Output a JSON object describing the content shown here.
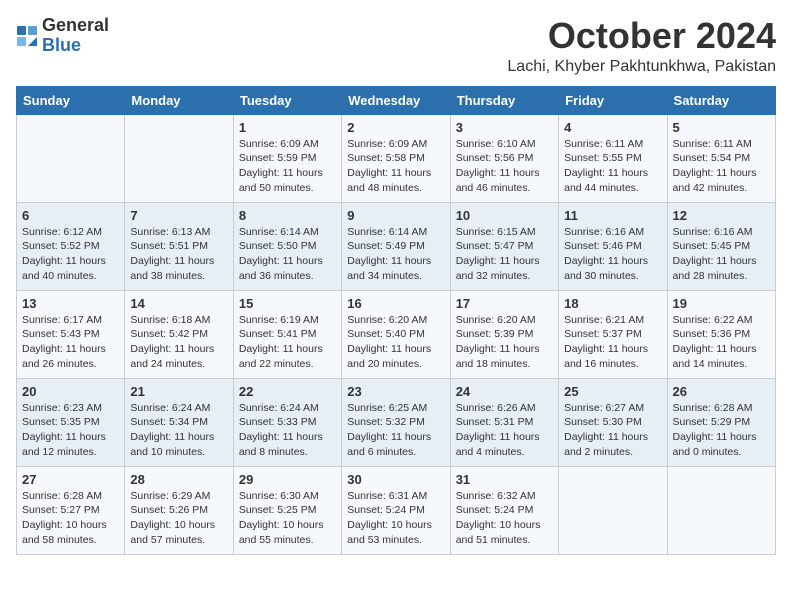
{
  "header": {
    "logo_general": "General",
    "logo_blue": "Blue",
    "month": "October 2024",
    "location": "Lachi, Khyber Pakhtunkhwa, Pakistan"
  },
  "weekdays": [
    "Sunday",
    "Monday",
    "Tuesday",
    "Wednesday",
    "Thursday",
    "Friday",
    "Saturday"
  ],
  "weeks": [
    [
      {
        "day": "",
        "text": ""
      },
      {
        "day": "",
        "text": ""
      },
      {
        "day": "1",
        "text": "Sunrise: 6:09 AM\nSunset: 5:59 PM\nDaylight: 11 hours and 50 minutes."
      },
      {
        "day": "2",
        "text": "Sunrise: 6:09 AM\nSunset: 5:58 PM\nDaylight: 11 hours and 48 minutes."
      },
      {
        "day": "3",
        "text": "Sunrise: 6:10 AM\nSunset: 5:56 PM\nDaylight: 11 hours and 46 minutes."
      },
      {
        "day": "4",
        "text": "Sunrise: 6:11 AM\nSunset: 5:55 PM\nDaylight: 11 hours and 44 minutes."
      },
      {
        "day": "5",
        "text": "Sunrise: 6:11 AM\nSunset: 5:54 PM\nDaylight: 11 hours and 42 minutes."
      }
    ],
    [
      {
        "day": "6",
        "text": "Sunrise: 6:12 AM\nSunset: 5:52 PM\nDaylight: 11 hours and 40 minutes."
      },
      {
        "day": "7",
        "text": "Sunrise: 6:13 AM\nSunset: 5:51 PM\nDaylight: 11 hours and 38 minutes."
      },
      {
        "day": "8",
        "text": "Sunrise: 6:14 AM\nSunset: 5:50 PM\nDaylight: 11 hours and 36 minutes."
      },
      {
        "day": "9",
        "text": "Sunrise: 6:14 AM\nSunset: 5:49 PM\nDaylight: 11 hours and 34 minutes."
      },
      {
        "day": "10",
        "text": "Sunrise: 6:15 AM\nSunset: 5:47 PM\nDaylight: 11 hours and 32 minutes."
      },
      {
        "day": "11",
        "text": "Sunrise: 6:16 AM\nSunset: 5:46 PM\nDaylight: 11 hours and 30 minutes."
      },
      {
        "day": "12",
        "text": "Sunrise: 6:16 AM\nSunset: 5:45 PM\nDaylight: 11 hours and 28 minutes."
      }
    ],
    [
      {
        "day": "13",
        "text": "Sunrise: 6:17 AM\nSunset: 5:43 PM\nDaylight: 11 hours and 26 minutes."
      },
      {
        "day": "14",
        "text": "Sunrise: 6:18 AM\nSunset: 5:42 PM\nDaylight: 11 hours and 24 minutes."
      },
      {
        "day": "15",
        "text": "Sunrise: 6:19 AM\nSunset: 5:41 PM\nDaylight: 11 hours and 22 minutes."
      },
      {
        "day": "16",
        "text": "Sunrise: 6:20 AM\nSunset: 5:40 PM\nDaylight: 11 hours and 20 minutes."
      },
      {
        "day": "17",
        "text": "Sunrise: 6:20 AM\nSunset: 5:39 PM\nDaylight: 11 hours and 18 minutes."
      },
      {
        "day": "18",
        "text": "Sunrise: 6:21 AM\nSunset: 5:37 PM\nDaylight: 11 hours and 16 minutes."
      },
      {
        "day": "19",
        "text": "Sunrise: 6:22 AM\nSunset: 5:36 PM\nDaylight: 11 hours and 14 minutes."
      }
    ],
    [
      {
        "day": "20",
        "text": "Sunrise: 6:23 AM\nSunset: 5:35 PM\nDaylight: 11 hours and 12 minutes."
      },
      {
        "day": "21",
        "text": "Sunrise: 6:24 AM\nSunset: 5:34 PM\nDaylight: 11 hours and 10 minutes."
      },
      {
        "day": "22",
        "text": "Sunrise: 6:24 AM\nSunset: 5:33 PM\nDaylight: 11 hours and 8 minutes."
      },
      {
        "day": "23",
        "text": "Sunrise: 6:25 AM\nSunset: 5:32 PM\nDaylight: 11 hours and 6 minutes."
      },
      {
        "day": "24",
        "text": "Sunrise: 6:26 AM\nSunset: 5:31 PM\nDaylight: 11 hours and 4 minutes."
      },
      {
        "day": "25",
        "text": "Sunrise: 6:27 AM\nSunset: 5:30 PM\nDaylight: 11 hours and 2 minutes."
      },
      {
        "day": "26",
        "text": "Sunrise: 6:28 AM\nSunset: 5:29 PM\nDaylight: 11 hours and 0 minutes."
      }
    ],
    [
      {
        "day": "27",
        "text": "Sunrise: 6:28 AM\nSunset: 5:27 PM\nDaylight: 10 hours and 58 minutes."
      },
      {
        "day": "28",
        "text": "Sunrise: 6:29 AM\nSunset: 5:26 PM\nDaylight: 10 hours and 57 minutes."
      },
      {
        "day": "29",
        "text": "Sunrise: 6:30 AM\nSunset: 5:25 PM\nDaylight: 10 hours and 55 minutes."
      },
      {
        "day": "30",
        "text": "Sunrise: 6:31 AM\nSunset: 5:24 PM\nDaylight: 10 hours and 53 minutes."
      },
      {
        "day": "31",
        "text": "Sunrise: 6:32 AM\nSunset: 5:24 PM\nDaylight: 10 hours and 51 minutes."
      },
      {
        "day": "",
        "text": ""
      },
      {
        "day": "",
        "text": ""
      }
    ]
  ]
}
